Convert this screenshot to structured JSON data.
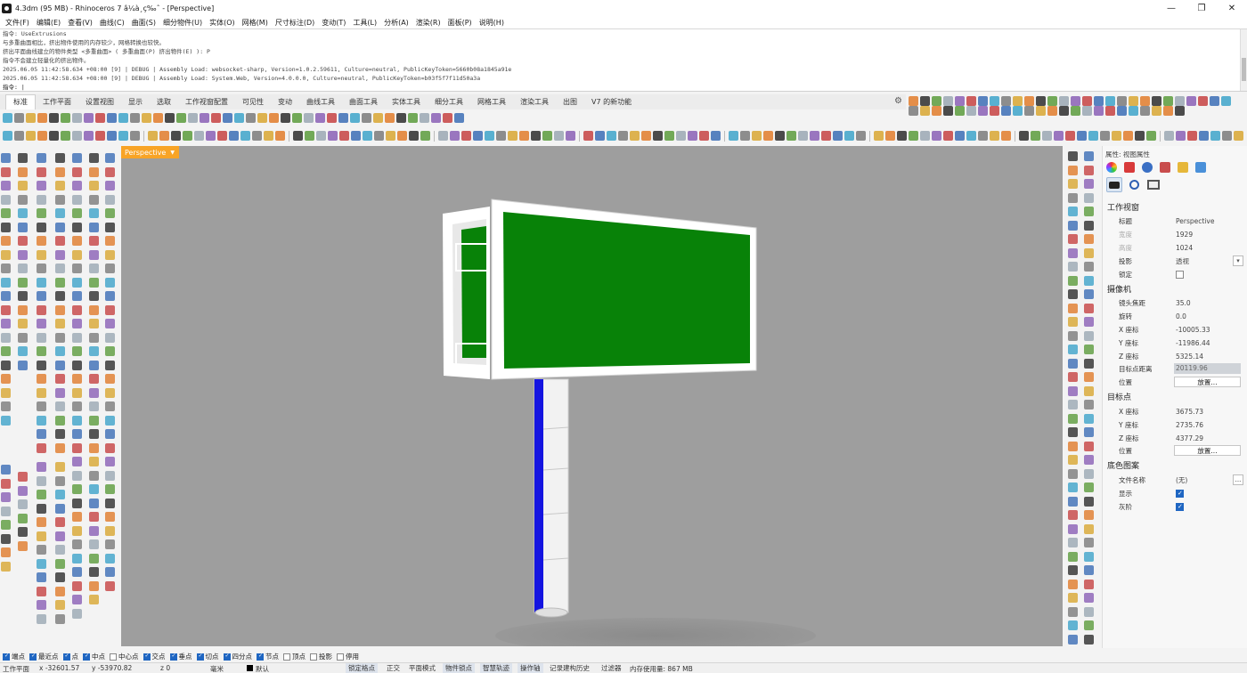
{
  "window": {
    "title": "4.3dm (95 MB) - Rhinoceros 7 â¼à¸ç‰ˆ - [Perspective]",
    "minimize": "—",
    "maximize": "❐",
    "close": "✕"
  },
  "menu": [
    "文件(F)",
    "编辑(E)",
    "查看(V)",
    "曲线(C)",
    "曲面(S)",
    "细分物件(U)",
    "实体(O)",
    "网格(M)",
    "尺寸标注(D)",
    "变动(T)",
    "工具(L)",
    "分析(A)",
    "渲染(R)",
    "面板(P)",
    "说明(H)"
  ],
  "command_history": [
    "指令: UseExtrusions",
    "与多重曲面相比，挤出物件使用的内存较少，网格转换也较快。",
    "挤出平面曲线建立的物件类型 <多重曲面> ( 多重曲面(P)  挤出物件(E) ): P",
    "指令不会建立轻量化的挤出物件。",
    "2025.06.05 11:42:58.634 +08:00 [9] | DEBUG | Assembly Load: websocket-sharp, Version=1.0.2.59611, Culture=neutral, PublicKeyToken=5660b08a1845a91e",
    "2025.06.05 11:42:58.634 +08:00 [9] | DEBUG | Assembly Load: System.Web, Version=4.0.0.0, Culture=neutral, PublicKeyToken=b03f5f7f11d50a3a",
    "指令: |"
  ],
  "tabs": [
    {
      "label": "标准",
      "active": true
    },
    {
      "label": "工作平面"
    },
    {
      "label": "设置视图"
    },
    {
      "label": "显示"
    },
    {
      "label": "选取"
    },
    {
      "label": "工作视窗配置"
    },
    {
      "label": "可见性"
    },
    {
      "label": "变动"
    },
    {
      "label": "曲线工具"
    },
    {
      "label": "曲面工具"
    },
    {
      "label": "实体工具"
    },
    {
      "label": "细分工具"
    },
    {
      "label": "网格工具"
    },
    {
      "label": "渲染工具"
    },
    {
      "label": "出图"
    },
    {
      "label": "V7 的新功能"
    }
  ],
  "viewport": {
    "label": "Perspective",
    "background": "#9e9e9e",
    "screen_color": "#088208",
    "frame_color": "#ffffff",
    "pole_stripe_color": "#1414e0"
  },
  "properties": {
    "panel_title": "属性: 视图属性",
    "section_viewport": "工作视窗",
    "title_label": "标题",
    "title_value": "Perspective",
    "width_label": "宽度",
    "width_value": "1929",
    "height_label": "高度",
    "height_value": "1024",
    "projection_label": "投影",
    "projection_value": "透视",
    "locked_label": "锁定",
    "section_camera": "摄像机",
    "lens_label": "镜头焦距",
    "lens_value": "35.0",
    "rotation_label": "旋转",
    "rotation_value": "0.0",
    "cam_x_label": "X 座标",
    "cam_x_value": "-10005.33",
    "cam_y_label": "Y 座标",
    "cam_y_value": "-11986.44",
    "cam_z_label": "Z 座标",
    "cam_z_value": "5325.14",
    "target_dist_label": "目标点距离",
    "target_dist_value": "20119.96",
    "cam_pos_label": "位置",
    "cam_place_button": "放置...",
    "section_target": "目标点",
    "tgt_x_label": "X 座标",
    "tgt_x_value": "3675.73",
    "tgt_y_label": "Y 座标",
    "tgt_y_value": "2735.76",
    "tgt_z_label": "Z 座标",
    "tgt_z_value": "4377.29",
    "tgt_pos_label": "位置",
    "tgt_place_button": "放置...",
    "section_wallpaper": "底色图案",
    "filename_label": "文件名称",
    "filename_value": "(无)",
    "show_label": "显示",
    "show_checked": true,
    "gray_label": "灰阶",
    "gray_checked": true,
    "dots": "..."
  },
  "osnap": [
    {
      "label": "端点",
      "checked": true
    },
    {
      "label": "最近点",
      "checked": true
    },
    {
      "label": "点",
      "checked": true
    },
    {
      "label": "中点",
      "checked": true
    },
    {
      "label": "中心点",
      "checked": false
    },
    {
      "label": "交点",
      "checked": true
    },
    {
      "label": "垂点",
      "checked": true
    },
    {
      "label": "切点",
      "checked": true
    },
    {
      "label": "四分点",
      "checked": true
    },
    {
      "label": "节点",
      "checked": true
    },
    {
      "label": "顶点",
      "checked": false
    },
    {
      "label": "投影",
      "checked": false
    },
    {
      "label": "停用",
      "checked": false
    }
  ],
  "status": {
    "cplane": "工作平面",
    "x": "x -32601.57",
    "y": "y -53970.82",
    "z": "z 0",
    "units": "毫米",
    "layer": "默认",
    "grid_snap": "锁定格点",
    "ortho": "正交",
    "planar": "平面模式",
    "osnap": "物件锁点",
    "smarttrack": "智慧轨迹",
    "gumball": "操作轴",
    "history": "记录建构历史",
    "filter": "过滤器",
    "memory": "内存使用量: 867 MB"
  }
}
